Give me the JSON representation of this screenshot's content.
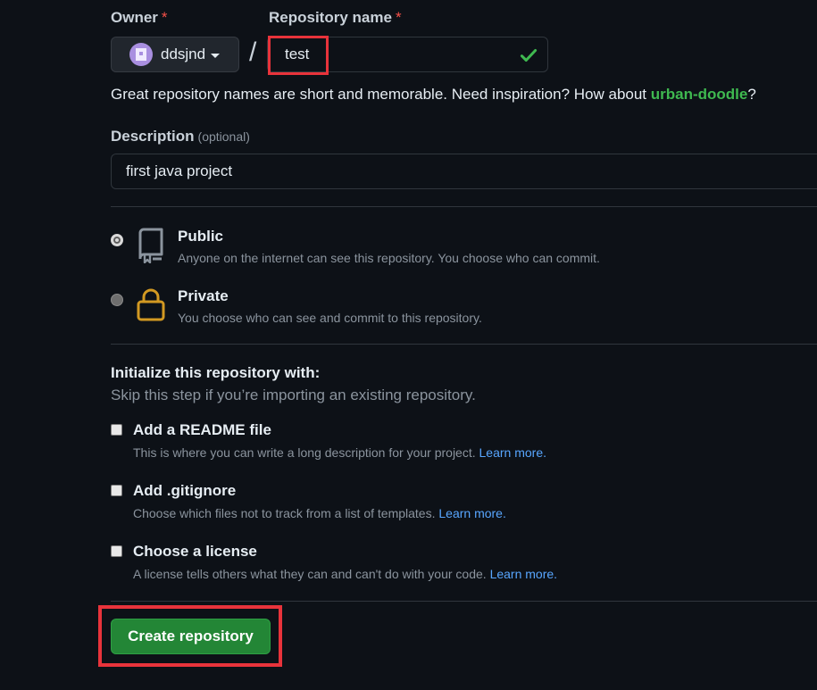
{
  "owner": {
    "label": "Owner",
    "required_mark": "*",
    "selected": "ddsjnd"
  },
  "repo_name": {
    "label": "Repository name",
    "required_mark": "*",
    "value": "test",
    "valid_icon": "check-icon"
  },
  "separator": "/",
  "hint": {
    "text": "Great repository names are short and memorable. Need inspiration? How about ",
    "suggestion": "urban-doodle",
    "suffix": "?"
  },
  "description": {
    "label": "Description",
    "optional": "(optional)",
    "value": "first java project"
  },
  "visibility": {
    "public": {
      "title": "Public",
      "desc": "Anyone on the internet can see this repository. You choose who can commit.",
      "icon": "repo-book-icon",
      "checked": true
    },
    "private": {
      "title": "Private",
      "desc": "You choose who can see and commit to this repository.",
      "icon": "lock-icon",
      "checked": false
    }
  },
  "init": {
    "title": "Initialize this repository with:",
    "subtitle": "Skip this step if you’re importing an existing repository.",
    "readme": {
      "title": "Add a README file",
      "desc": "This is where you can write a long description for your project. ",
      "link": "Learn more."
    },
    "gitignore": {
      "title": "Add .gitignore",
      "desc": "Choose which files not to track from a list of templates. ",
      "link": "Learn more."
    },
    "license": {
      "title": "Choose a license",
      "desc": "A license tells others what they can and can't do with your code. ",
      "link": "Learn more."
    }
  },
  "create_button": "Create repository",
  "colors": {
    "background": "#0d1117",
    "accent_green": "#238636",
    "link_blue": "#58a6ff",
    "highlight_red": "#e8333b",
    "lock_orange": "#d29922"
  }
}
